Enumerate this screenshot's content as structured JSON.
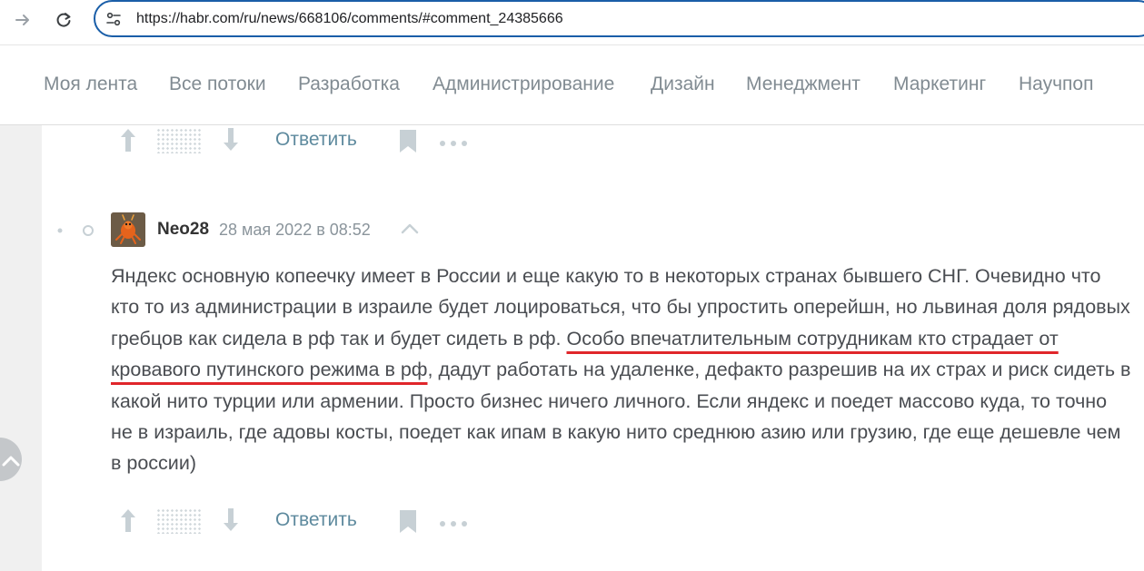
{
  "browser": {
    "url": "https://habr.com/ru/news/668106/comments/#comment_24385666"
  },
  "habr_nav": {
    "items": [
      "Моя лента",
      "Все потоки",
      "Разработка",
      "Администрирование",
      "Дизайн",
      "Менеджмент",
      "Маркетинг",
      "Научпоп"
    ]
  },
  "previous_comment_actions": {
    "reply_label": "Ответить"
  },
  "comment": {
    "author": "Neo28",
    "date": "28 мая 2022 в 08:52",
    "text_before": "Яндекс основную копеечку имеет в России и еще какую то в некоторых странах бывшего СНГ. Очевидно что кто то из администрации в израиле будет лоцироваться, что бы упростить оперейшн, но львиная доля рядовых гребцов как сидела в рф так и будет сидеть в рф. ",
    "text_highlighted": "Особо впечатлительным сотрудникам кто страдает от кровавого путинского режима в рф",
    "text_after": ", дадут работать на удаленке, дефакто разрешив на их страх и риск сидеть в какой нито турции или армении. Просто бизнес ничего личного. Если яндекс и поедет массово куда, то точно не в израиль, где адовы косты, поедет как ипам в какую нито среднюю азию или грузию, где еще дешевле чем в россии)",
    "reply_label": "Ответить"
  },
  "colors": {
    "link": "#5e8a9e",
    "nav_text": "#818b92",
    "highlight_underline": "#e0262b",
    "address_focus": "#1a5ea8"
  }
}
